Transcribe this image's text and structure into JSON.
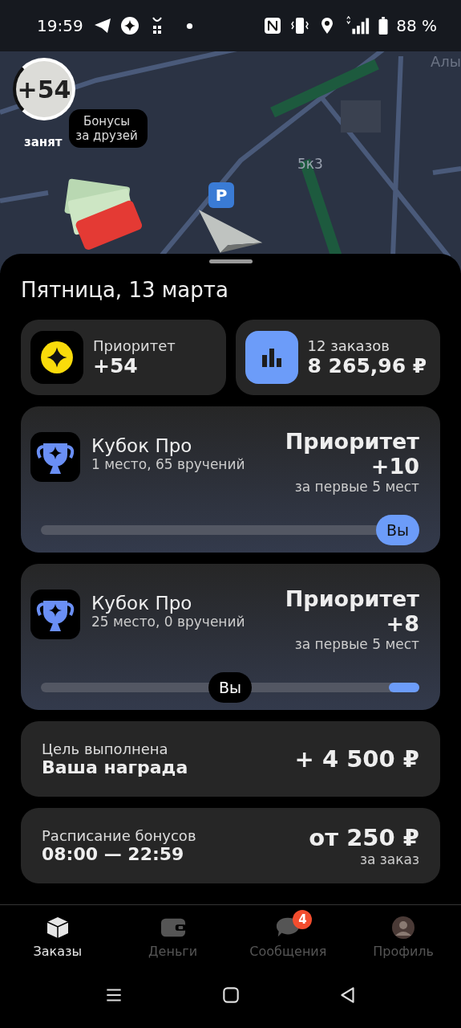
{
  "status_bar": {
    "time": "19:59",
    "battery": "88 %"
  },
  "map": {
    "street_label": "Алы",
    "building_label": "5к3",
    "priority_bubble": "+54",
    "tooltip": "Бонусы за друзей",
    "status": "занят",
    "parking": "P"
  },
  "sheet": {
    "title": "Пятница, 13 марта",
    "summary": [
      {
        "kind": "priority",
        "label": "Приоритет",
        "value": "+54"
      },
      {
        "kind": "orders",
        "label": "12 заказов",
        "value": "8 265,96 ₽"
      }
    ],
    "contests": [
      {
        "title": "Кубок Про",
        "subtitle": "1 место, 65 вручений",
        "reward_title": "Приоритет",
        "reward_value": "+10",
        "reward_note": "за первые 5 мест",
        "marker": "Вы",
        "level": 1,
        "leader": true
      },
      {
        "title": "Кубок Про",
        "subtitle": "25 место, 0 вручений",
        "reward_title": "Приоритет",
        "reward_value": "+8",
        "reward_note": "за первые 5 мест",
        "marker": "Вы",
        "level": 0.5,
        "leader": false
      }
    ],
    "goal": {
      "label": "Цель выполнена",
      "title": "Ваша награда",
      "amount": "+ 4 500 ₽"
    },
    "schedule": {
      "label": "Расписание бонусов",
      "hours": "08:00 — 22:59",
      "amount": "от 250 ₽",
      "note": "за заказ"
    }
  },
  "tabs": [
    {
      "kind": "orders",
      "label": "Заказы",
      "selected": true
    },
    {
      "kind": "money",
      "label": "Деньги",
      "selected": false
    },
    {
      "kind": "messages",
      "label": "Сообщения",
      "selected": false,
      "badge": "4"
    },
    {
      "kind": "profile",
      "label": "Профиль",
      "selected": false
    }
  ]
}
